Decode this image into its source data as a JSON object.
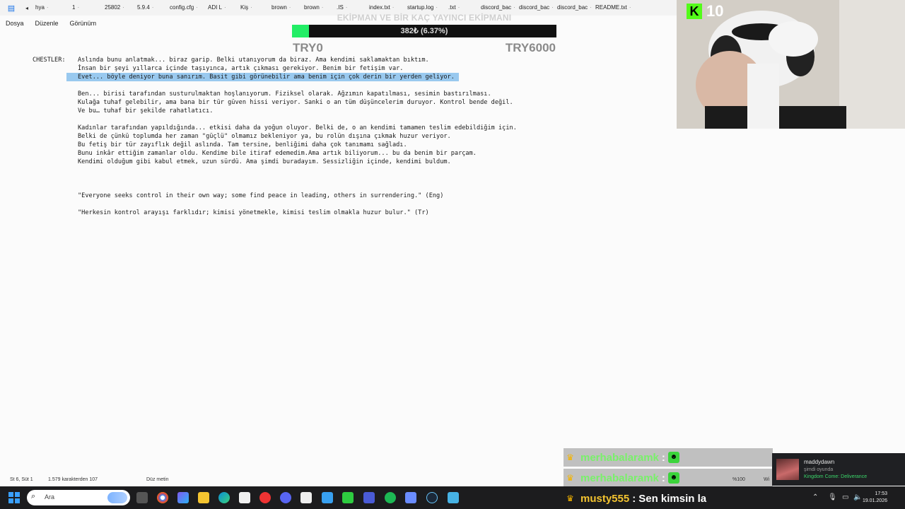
{
  "tabs": [
    "hya",
    "1",
    "25802",
    "5.9.4",
    "config.cfg",
    "ADI L",
    "Kiş",
    "brown",
    "brown",
    ".IS",
    "index.txt",
    "startup.log",
    ".txt",
    "discord_bac",
    "discord_bac",
    "discord_bac",
    "README.txt"
  ],
  "menu": [
    "Dosya",
    "Düzenle",
    "Görünüm"
  ],
  "document": {
    "speaker": "CHESTLER:",
    "lines": [
      "Aslında bunu anlatmak... biraz garip. Belki utanıyorum da biraz. Ama kendimi saklamaktan bıktım.",
      "İnsan bir şeyi yıllarca içinde taşıyınca, artık çıkması gerekiyor. Benim bir fetişim var.",
      "Evet... böyle deniyor buna sanırım. Basit gibi görünebilir ama benim için çok derin bir yerden geliyor.",
      "",
      "Ben... birisi tarafından susturulmaktan hoşlanıyorum. Fiziksel olarak. Ağzımın kapatılması, sesimin bastırılması.",
      "Kulağa tuhaf gelebilir, ama bana bir tür güven hissi veriyor. Sanki o an tüm düşüncelerim duruyor. Kontrol bende değil.",
      "Ve bu… tuhaf bir şekilde rahatlatıcı.",
      "",
      "Kadınlar tarafından yapıldığında... etkisi daha da yoğun oluyor. Belki de, o an kendimi tamamen teslim edebildiğim için.",
      "Belki de çünkü toplumda her zaman \"güçlü\" olmamız bekleniyor ya, bu rolün dışına çıkmak huzur veriyor.",
      "Bu fetiş bir tür zayıflık değil aslında. Tam tersine, benliğimi daha çok tanımamı sağladı.",
      "Bunu inkâr ettiğim zamanlar oldu. Kendime bile itiraf edemedim.Ama artık biliyorum... bu da benim bir parçam.",
      "Kendimi olduğum gibi kabul etmek, uzun sürdü. Ama şimdi buradayım. Sessizliğin içinde, kendimi buldum.",
      "",
      "",
      "",
      "\"Everyone seeks control in their own way; some find peace in leading, others in surrendering.\" (Eng)",
      "",
      "\"Herkesin kontrol arayışı farklıdır; kimisi yönetmekle, kimisi teslim olmakla huzur bulur.\" (Tr)"
    ],
    "selected_line_index": 2
  },
  "status": {
    "position": "St 6, Süt 1",
    "chars": "1.579 karakterden 107",
    "mode": "Düz metin",
    "zoom": "%100",
    "encoding": "Wi"
  },
  "donation": {
    "title": "EKİPMAN VE BİR KAÇ YAYINCI EKİPMANI",
    "progress_text": "382₺ (6.37%)",
    "progress_fraction": 0.0637,
    "left_label": "TRY0",
    "right_label": "TRY6000",
    "fill_color": "#22ee66"
  },
  "webcam": {
    "viewer_count": "10",
    "platform_icon": "kick-logo-icon"
  },
  "chat": [
    {
      "user": "merhabalaramk",
      "colon": ":",
      "message": ""
    },
    {
      "user": "merhabalaramk",
      "colon": ":",
      "message": ""
    },
    {
      "user": "musty555",
      "colon": ":",
      "message": "Sen kimsin la"
    }
  ],
  "presence": {
    "name": "maddydawn",
    "state": "şimdi oyunda",
    "game": "Kingdom Come: Deliverance"
  },
  "taskbar": {
    "search_placeholder": "Ara",
    "time": "17:53",
    "date": "19.01.2026"
  }
}
